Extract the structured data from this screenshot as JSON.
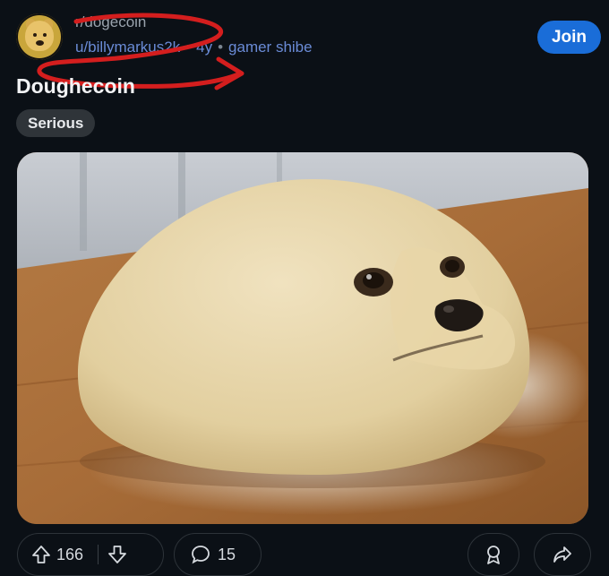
{
  "post": {
    "subreddit": "r/dogecoin",
    "author": "u/billymarkus2k",
    "age": "4y",
    "user_flair": "gamer shibe",
    "title": "Doughecoin",
    "post_flair": "Serious",
    "image_description": "doge-shaped dough ball on wooden board"
  },
  "actions": {
    "join_label": "Join",
    "upvotes": "166",
    "comments": "15"
  },
  "colors": {
    "background": "#0b1016",
    "join_button": "#1a6dd8",
    "username_link": "#6a8bd6",
    "annotation_scribble": "#d41e1e"
  },
  "icons": [
    "subreddit-avatar",
    "upvote-icon",
    "downvote-icon",
    "comment-icon",
    "award-icon",
    "share-icon"
  ]
}
